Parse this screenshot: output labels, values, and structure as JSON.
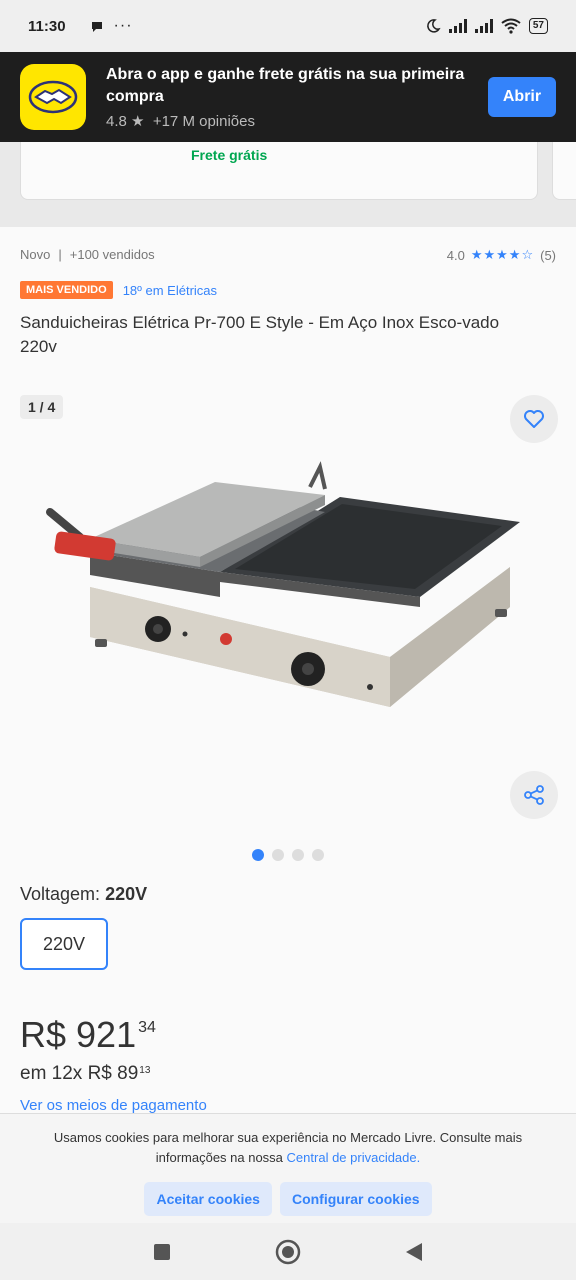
{
  "status_bar": {
    "time": "11:30",
    "battery": "57"
  },
  "background_card": {
    "shipping": "Frete grátis"
  },
  "app_banner": {
    "title": "Abra o app e ganhe frete grátis na sua primeira compra",
    "rating": "4.8",
    "reviews": "+17 M opiniões",
    "open_label": "Abrir"
  },
  "product": {
    "condition": "Novo",
    "sold": "+100 vendidos",
    "rating_value": "4.0",
    "stars": "★★★★☆",
    "rating_count": "(5)",
    "badge": "MAIS VENDIDO",
    "rank": "18º em Elétricas",
    "title": "Sanduicheiras Elétrica Pr-700 E Style - Em Aço Inox Esco-vado 220v",
    "image_counter": "1 / 4",
    "image_count": 4,
    "image_active": 1,
    "variant_label": "Voltagem:",
    "variant_selected": "220V",
    "variant_option": "220V",
    "price_main": "R$ 921",
    "price_cents": "34",
    "installments_prefix": "em 12x R$ 89",
    "installments_cents": "13",
    "payment_link": "Ver os meios de pagamento"
  },
  "cookie": {
    "text": "Usamos cookies para melhorar sua experiência no Mercado Livre. Consulte mais informações na nossa",
    "link": "Central de privacidade.",
    "accept": "Aceitar cookies",
    "configure": "Configurar cookies"
  },
  "colors": {
    "accent": "#3483fa",
    "badge": "#ff7733",
    "shipping": "#00a650",
    "brand": "#ffe600"
  },
  "icons": [
    "dots-icon",
    "moon-icon",
    "signal-icon",
    "wifi-icon",
    "battery-icon",
    "heart-icon",
    "share-icon",
    "star-icon",
    "square-nav-icon",
    "circle-nav-icon",
    "back-nav-icon"
  ]
}
